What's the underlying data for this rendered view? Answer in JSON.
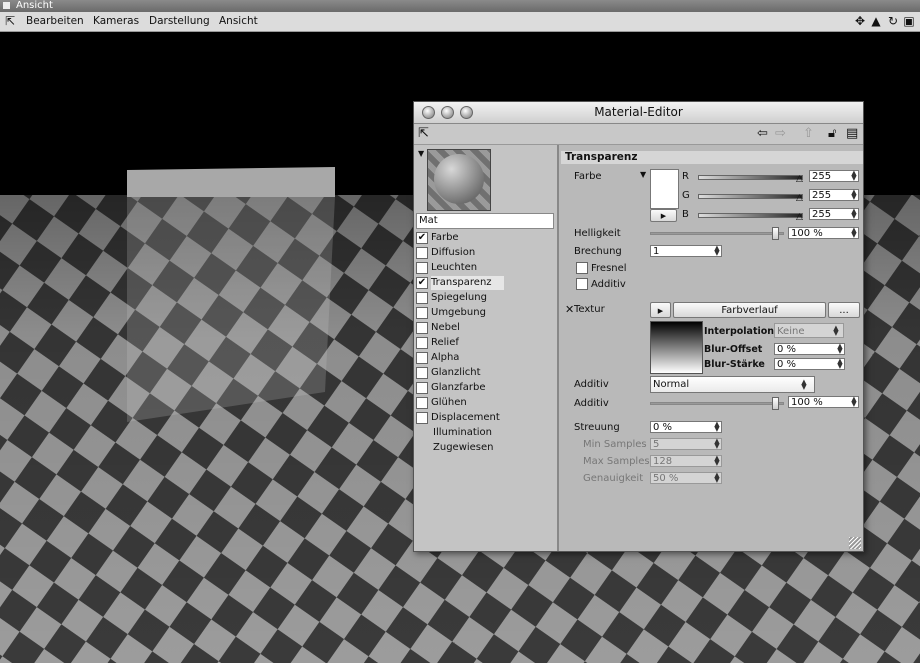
{
  "viewport": {
    "title": "Ansicht",
    "menu": [
      "Bearbeiten",
      "Kameras",
      "Darstellung",
      "Ansicht"
    ]
  },
  "editor": {
    "title": "Material-Editor",
    "material_name": "Mat",
    "channels": [
      {
        "label": "Farbe",
        "checked": true
      },
      {
        "label": "Diffusion",
        "checked": false
      },
      {
        "label": "Leuchten",
        "checked": false
      },
      {
        "label": "Transparenz",
        "checked": true,
        "selected": true
      },
      {
        "label": "Spiegelung",
        "checked": false
      },
      {
        "label": "Umgebung",
        "checked": false
      },
      {
        "label": "Nebel",
        "checked": false
      },
      {
        "label": "Relief",
        "checked": false
      },
      {
        "label": "Alpha",
        "checked": false
      },
      {
        "label": "Glanzlicht",
        "checked": false
      },
      {
        "label": "Glanzfarbe",
        "checked": false
      },
      {
        "label": "Glühen",
        "checked": false
      },
      {
        "label": "Displacement",
        "checked": false
      }
    ],
    "extra_items": [
      "Illumination",
      "Zugewiesen"
    ],
    "section": "Transparenz",
    "farbe": {
      "label": "Farbe",
      "r_label": "R",
      "r": "255",
      "g_label": "G",
      "g": "255",
      "b_label": "B",
      "b": "255"
    },
    "helligkeit": {
      "label": "Helligkeit",
      "value": "100 %",
      "fraction": 1.0
    },
    "brechung": {
      "label": "Brechung",
      "value": "1"
    },
    "fresnel": "Fresnel",
    "additiv_check": "Additiv",
    "textur": {
      "label": "Textur",
      "shader": "Farbverlauf",
      "more": "...",
      "interpolation_label": "Interpolation",
      "interpolation_value": "Keine",
      "blur_offset_label": "Blur-Offset",
      "blur_offset_value": "0 %",
      "blur_staerke_label": "Blur-Stärke",
      "blur_staerke_value": "0 %"
    },
    "additiv_mode": {
      "label": "Additiv",
      "value": "Normal"
    },
    "additiv_strength": {
      "label": "Additiv",
      "value": "100 %",
      "fraction": 1.0
    },
    "streuung": {
      "label": "Streuung",
      "value": "0 %"
    },
    "min_samples": {
      "label": "Min Samples",
      "value": "5"
    },
    "max_samples": {
      "label": "Max Samples",
      "value": "128"
    },
    "genauigkeit": {
      "label": "Genauigkeit",
      "value": "50 %"
    }
  }
}
